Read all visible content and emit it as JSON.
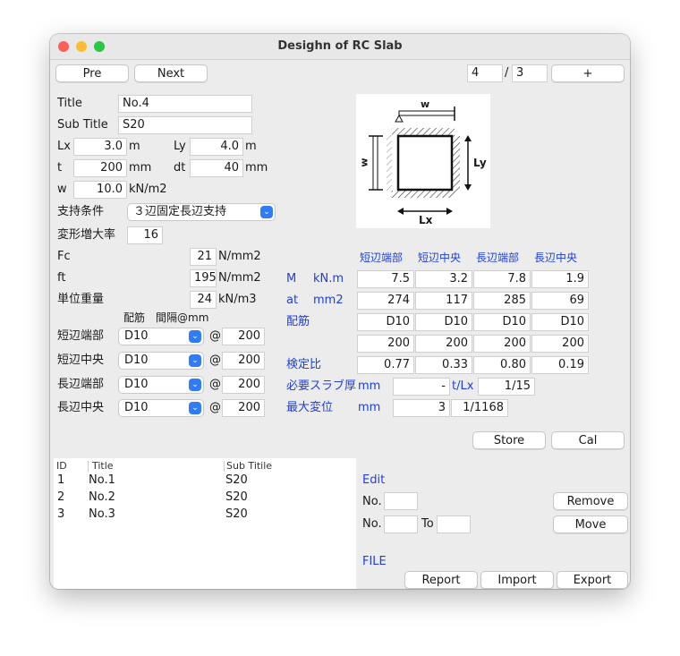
{
  "window": {
    "title": "Desighn of RC Slab"
  },
  "nav": {
    "pre": "Pre",
    "next": "Next",
    "current": "4",
    "slash": "/",
    "total": "3",
    "add": "+"
  },
  "form": {
    "title_label": "Title",
    "title_value": "No.4",
    "subtitle_label": "Sub Title",
    "subtitle_value": "S20",
    "lx_label": "Lx",
    "lx_value": "3.0",
    "lx_unit": "m",
    "ly_label": "Ly",
    "ly_value": "4.0",
    "ly_unit": "m",
    "t_label": "t",
    "t_value": "200",
    "t_unit": "mm",
    "dt_label": "dt",
    "dt_value": "40",
    "dt_unit": "mm",
    "w_label": "w",
    "w_value": "10.0",
    "w_unit": "kN/m2",
    "support_label": "支持条件",
    "support_value": "３辺固定長辺支持",
    "deform_label": "変形増大率",
    "deform_value": "16",
    "fc_label": "Fc",
    "fc_value": "21",
    "fc_unit": "N/mm2",
    "ft_label": "ft",
    "ft_value": "195",
    "ft_unit": "N/mm2",
    "weight_label": "単位重量",
    "weight_value": "24",
    "weight_unit": "kN/m3"
  },
  "rebar": {
    "header_bar": "配筋",
    "header_pitch": "間隔@mm",
    "at": "@",
    "rows": [
      {
        "label": "短辺端部",
        "bar": "D10",
        "pitch": "200"
      },
      {
        "label": "短辺中央",
        "bar": "D10",
        "pitch": "200"
      },
      {
        "label": "長辺端部",
        "bar": "D10",
        "pitch": "200"
      },
      {
        "label": "長辺中央",
        "bar": "D10",
        "pitch": "200"
      }
    ]
  },
  "diagram": {
    "w_top": "w",
    "w_left": "w",
    "ly": "Ly",
    "lx": "Lx"
  },
  "results": {
    "headers": [
      "短辺端部",
      "短辺中央",
      "長辺端部",
      "長辺中央"
    ],
    "m_label": "M",
    "m_unit": "kN.m",
    "m_values": [
      "7.5",
      "3.2",
      "7.8",
      "1.9"
    ],
    "at_label": "at",
    "at_unit": "mm2",
    "at_values": [
      "274",
      "117",
      "285",
      "69"
    ],
    "haikin_label": "配筋",
    "bar_values": [
      "D10",
      "D10",
      "D10",
      "D10"
    ],
    "pitch_values": [
      "200",
      "200",
      "200",
      "200"
    ],
    "ratio_label": "検定比",
    "ratio_values": [
      "0.77",
      "0.33",
      "0.80",
      "0.19"
    ],
    "thick_label": "必要スラブ厚",
    "thick_unit": "mm",
    "thick_value": "-",
    "tlx_label": "t/Lx",
    "tlx_value": "1/15",
    "defl_label": "最大変位",
    "defl_unit": "mm",
    "defl_value": "3",
    "defl_ratio": "1/1168"
  },
  "actions": {
    "store": "Store",
    "cal": "Cal"
  },
  "list": {
    "headers": {
      "id": "ID",
      "title": "Title",
      "subtitle": "Sub Titile"
    },
    "rows": [
      {
        "id": "1",
        "title": "No.1",
        "subtitle": "S20"
      },
      {
        "id": "2",
        "title": "No.2",
        "subtitle": "S20"
      },
      {
        "id": "3",
        "title": "No.3",
        "subtitle": "S20"
      }
    ]
  },
  "edit": {
    "label": "Edit",
    "no_label": "No.",
    "to_label": "To",
    "remove": "Remove",
    "move": "Move"
  },
  "file": {
    "label": "FILE",
    "report": "Report",
    "import": "Import",
    "export": "Export"
  },
  "colors": {
    "accent_blue": "#1f3fd8",
    "close": "#fe5f57",
    "minimize": "#febc2e",
    "zoom": "#28c840",
    "select_chevron": "#2f7cf6"
  }
}
